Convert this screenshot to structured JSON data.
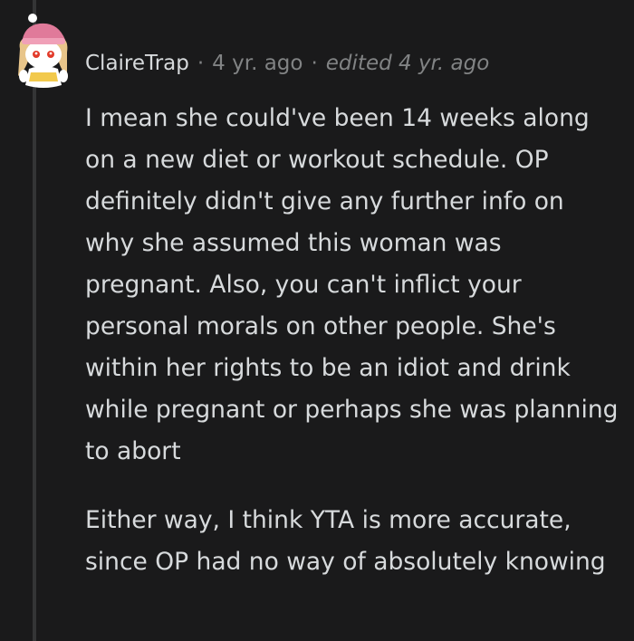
{
  "comment": {
    "author": "ClaireTrap",
    "separator": "·",
    "time": "4 yr. ago",
    "edited": "edited 4 yr. ago",
    "avatar_icon": "snoo-avatar-icon",
    "paragraphs": [
      "I mean she could've been 14 weeks along on a new diet or workout schedule. OP definitely didn't give any further info on why she assumed this woman was pregnant. Also, you can't inflict your personal morals on other people. She's within her rights to be an idiot and drink while pregnant or perhaps she was planning to abort",
      "Either way, I think YTA is more accurate, since OP had no way of absolutely knowing"
    ]
  },
  "colors": {
    "background": "#1a1a1b",
    "text": "#d7dadc",
    "meta": "#818384",
    "thread_line": "#343536"
  }
}
